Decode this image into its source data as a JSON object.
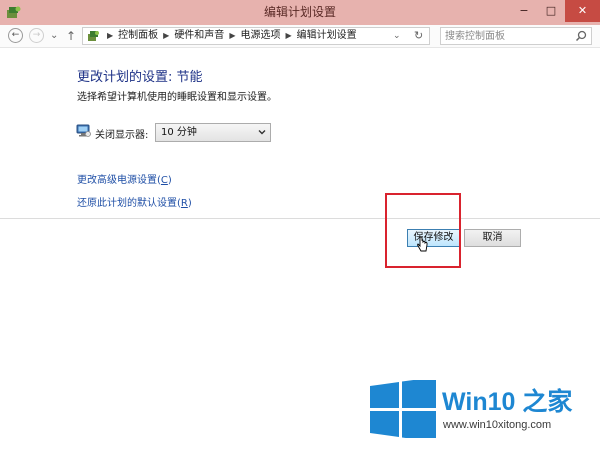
{
  "window": {
    "title": "编辑计划设置",
    "minimize": "−",
    "maximize": "□",
    "close": "✕"
  },
  "nav": {
    "back": "←",
    "forward": "→",
    "up": "↑",
    "breadcrumb": [
      "控制面板",
      "硬件和声音",
      "电源选项",
      "编辑计划设置"
    ],
    "dropdown": "⌄",
    "refresh": "↻"
  },
  "search": {
    "placeholder": "搜索控制面板",
    "value": ""
  },
  "main": {
    "title": "更改计划的设置: 节能",
    "subtitle": "选择希望计算机使用的睡眠设置和显示设置。",
    "display_off_label": "关闭显示器:",
    "display_off_value": "10 分钟",
    "advanced_link_text": "更改高级电源设置(",
    "advanced_link_key": "C",
    "restore_link_text": "还原此计划的默认设置(",
    "restore_link_key": "R",
    "link_close": ")"
  },
  "buttons": {
    "save": "保存修改",
    "cancel": "取消"
  },
  "watermark": {
    "brand": "Win10 之家",
    "url": "www.win10xitong.com",
    "logo_color": "#1e87d2"
  },
  "colors": {
    "titlebar": "#e7b2ae",
    "close_button": "#c64b43",
    "title_text": "#1e3287",
    "link": "#1f4fa6",
    "highlight_box": "#d9232e"
  }
}
